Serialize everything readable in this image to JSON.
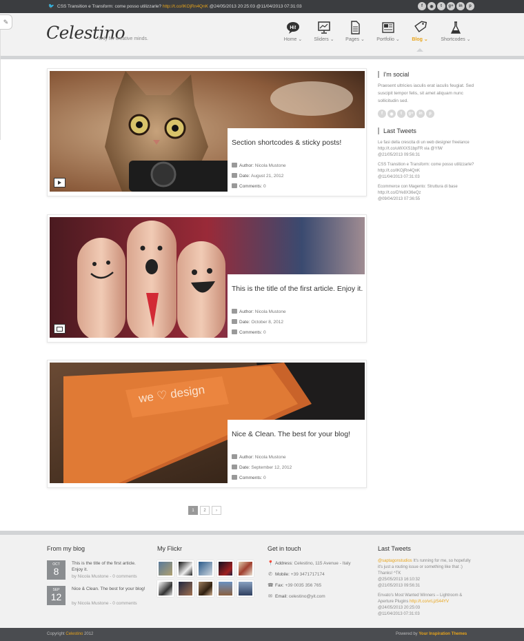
{
  "topbar": {
    "tweet_text": "CSS Transition e Transform: come posso utilizzarle?",
    "tweet_link": "http://t.co/IKOjRn4QnK",
    "tweet_time": "@24/05/2013 20:25:03 @11/04/2013 07:31:03",
    "social": [
      "f",
      "rss",
      "t",
      "g+",
      "in",
      "p"
    ]
  },
  "header": {
    "logo": "Celestino",
    "tagline": "only for creative minds.",
    "nav": [
      {
        "label": "Home",
        "icon": "hi-speech-icon"
      },
      {
        "label": "Sliders",
        "icon": "monitor-chart-icon"
      },
      {
        "label": "Pages",
        "icon": "document-icon"
      },
      {
        "label": "Portfolio",
        "icon": "portfolio-icon"
      },
      {
        "label": "Blog",
        "icon": "tag-icon"
      },
      {
        "label": "Shortcodes",
        "icon": "flask-icon"
      }
    ]
  },
  "posts": [
    {
      "title": "Section shortcodes & sticky posts!",
      "author_label": "Author:",
      "author": "Nicola Mustone",
      "date_label": "Date:",
      "date": "August 21, 2012",
      "comments_label": "Comments:",
      "comments": "0",
      "format_icon": "video-icon"
    },
    {
      "title": "This is the title of the first article. Enjoy it.",
      "author_label": "Author:",
      "author": "Nicola Mustone",
      "date_label": "Date:",
      "date": "October 8, 2012",
      "comments_label": "Comments:",
      "comments": "0",
      "format_icon": "image-icon"
    },
    {
      "title": "Nice & Clean. The best for your blog!",
      "author_label": "Author:",
      "author": "Nicola Mustone",
      "date_label": "Date:",
      "date": "September 12, 2012",
      "comments_label": "Comments:",
      "comments": "0",
      "format_icon": ""
    }
  ],
  "post_images": [
    {
      "text": ""
    },
    {
      "text": ""
    },
    {
      "text": "we ♡ design"
    }
  ],
  "pagination": [
    "1",
    "2",
    "›"
  ],
  "sidebar": {
    "social_title": "I'm social",
    "social_text": "Praesent ultricies iaculis erat iaculis feugiat. Sed suscipit tempor felis, sit amet aliquam nunc sollicitudin sed.",
    "social_icons": [
      "f",
      "rss",
      "t",
      "g+",
      "in",
      "p"
    ],
    "tweets_title": "Last Tweets",
    "tweets": [
      {
        "text": "Le fasi della crescita di un web designer freelance",
        "link": "http://t.co/uWXXS1bpFR via @YIW",
        "time": "@21/05/2013 09:56:31"
      },
      {
        "text": "CSS Transition e Transform: come posso utilizzarle?",
        "link": "http://t.co/IKOjRn4QnK",
        "time": "@11/04/2013 07:31:03"
      },
      {
        "text": "Ecommerce con Magento: Struttura di base",
        "link": "http://t.co/DYe8X36eQz",
        "time": "@09/04/2013 07:36:55"
      }
    ]
  },
  "footer": {
    "blog_title": "From my blog",
    "blog_items": [
      {
        "month": "OCT",
        "day": "8",
        "title": "This is the title of the first article. Enjoy it.",
        "by": "by Nicola Mustone - 0 comments"
      },
      {
        "month": "SEP",
        "day": "12",
        "title": "Nice & Clean. The best for your blog!",
        "by": "by Nicola Mustone - 0 comments"
      }
    ],
    "flickr_title": "My Flickr",
    "contact_title": "Get in touch",
    "contact": [
      {
        "label": "Address:",
        "value": "Celestino, 115 Avenue - Italy"
      },
      {
        "label": "Mobile:",
        "value": "+39 3471717174"
      },
      {
        "label": "Fax:",
        "value": "+39 0035 356 765"
      },
      {
        "label": "Email:",
        "value": "celestino@yit.com"
      }
    ],
    "tweets_title": "Last Tweets",
    "tweets": [
      {
        "user": "@saptagonstudios",
        "text": "It's running for me, so hopefully it's just a routing issue or something like that :) Thanks! ^TK",
        "time": "@25/05/2013 16:10:32"
      },
      {
        "user": "",
        "text": "@21/05/2013 09:56:31",
        "time": ""
      },
      {
        "user": "",
        "text": "Envato's Most Wanted Winners – Lightroom & Aperture Plugins",
        "link": "http://t.co/vrLjz544YV",
        "time": "@24/05/2013 20:25:03"
      },
      {
        "user": "",
        "text": "@11/04/2013 07:31:03",
        "time": ""
      }
    ]
  },
  "bottombar": {
    "copyright_prefix": "Copyright",
    "brand": "Celestino",
    "year": "2012",
    "powered_prefix": "Powered by",
    "powered_by": "Your Inspiration Themes"
  },
  "colors": {
    "accent": "#e8a41a",
    "topbar": "#3b3d40",
    "footer": "#f1f1f1"
  }
}
